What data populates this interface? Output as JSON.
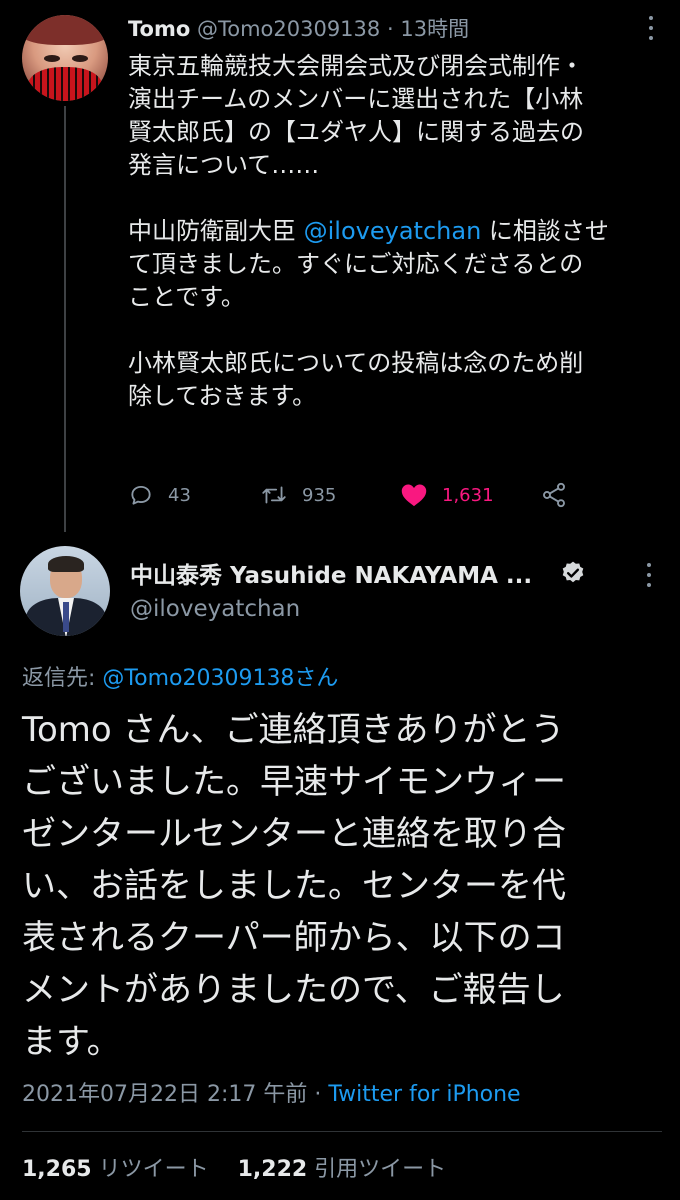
{
  "parent_tweet": {
    "name": "Tomo",
    "handle": "@Tomo20309138",
    "dot": "·",
    "time": "13時間",
    "body_lines": [
      "東京五輪競技大会開会式及び閉会式制作・",
      "演出チームのメンバーに選出された【小林",
      "賢太郎氏】の【ユダヤ人】に関する過去の",
      "発言について……"
    ],
    "para2_before": "中山防衛副大臣 ",
    "para2_mention": "@iloveyatchan",
    "para2_after1": " に相談させ",
    "para2_line2": "て頂きました。すぐにご対応くださるとの",
    "para2_line3": "ことです。",
    "para3_line1": "小林賢太郎氏についての投稿は念のため削",
    "para3_line2": "除しておきます。",
    "reply_count": "43",
    "retweet_count": "935",
    "like_count": "1,631"
  },
  "main_tweet": {
    "name": "中山泰秀 Yasuhide NAKAYAMA ...",
    "handle": "@iloveyatchan",
    "reply_label": "返信先: ",
    "reply_mention": "@Tomo20309138さん",
    "body_lines": [
      "Tomo さん、ご連絡頂きありがとう",
      "ございました。早速サイモンウィー",
      "ゼンタールセンターと連絡を取り合",
      "い、お話をしました。センターを代",
      "表されるクーパー師から、以下のコ",
      "メントがありましたので、ご報告し",
      "ます。"
    ],
    "timestamp": "2021年07月22日 2:17 午前 · ",
    "source": "Twitter for iPhone",
    "retweets_num": "1,265",
    "retweets_label": " リツイート",
    "quotes_num": "1,222",
    "quotes_label": " 引用ツイート"
  },
  "colors": {
    "background": "#000000",
    "text": "#e7e9ea",
    "secondary": "#8b98a5",
    "link": "#1d9bf0",
    "like": "#f91880"
  },
  "icons": [
    "more-icon",
    "reply-icon",
    "retweet-icon",
    "heart-icon",
    "share-icon",
    "verified-icon"
  ]
}
